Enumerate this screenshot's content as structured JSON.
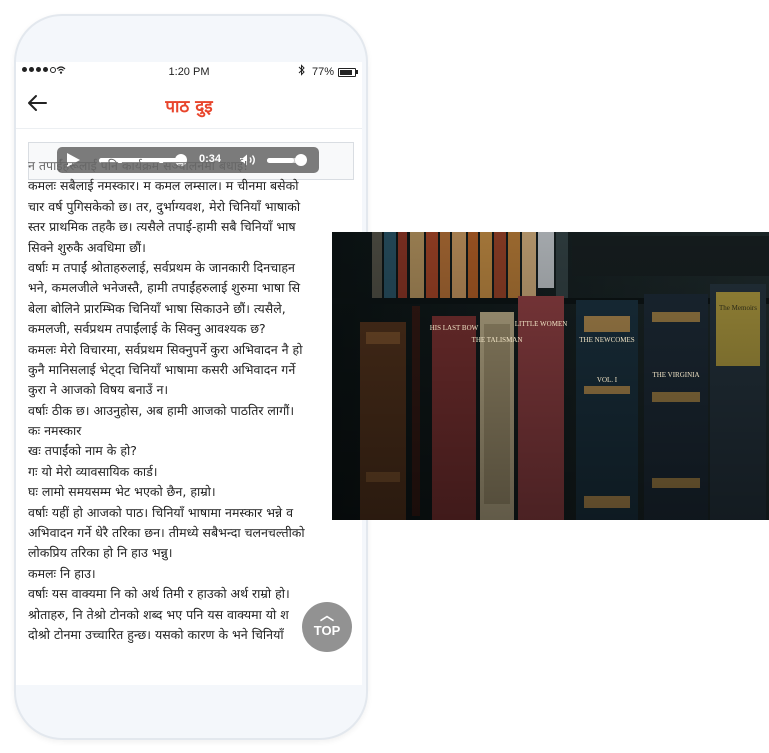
{
  "status_bar": {
    "time": "1:20 PM",
    "battery": "77%",
    "battery_level": 0.77
  },
  "header": {
    "title": "पाठ दुइ",
    "back_icon": "arrow-left-icon"
  },
  "player": {
    "time": "0:34",
    "progress": 0.92,
    "volume": 0.72
  },
  "lesson_lines": [
    "न तपाईंहरूलाई पनि कार्यक्रम सञ्चालनमा बधाई!",
    "कमलः सबैलाई नमस्कार। म कमल लम्साल। म चीनमा बसेको",
    "चार वर्ष पुगिसकेको छ। तर, दुर्भाग्यवश, मेरो चिनियाँ भाषाको",
    "स्तर प्राथमिक तहकै छ। त्यसैले तपाई-हामी सबै चिनियाँ भाष",
    "सिक्ने शुरुकै अवधिमा छौं।",
    "वर्षाः म तपाईं श्रोताहरुलाई, सर्वप्रथम के जानकारी दिनचाहन",
    "भने, कमलजीले भनेजस्तै, हामी तपाईंहरुलाई शुरुमा भाषा सि",
    "बेला बोलिने प्रारम्भिक चिनियाँ भाषा सिकाउने छौं। त्यसैले,",
    "कमलजी, सर्वप्रथम तपाईंलाई के सिक्नु आवश्यक छ?",
    "कमलः मेरो विचारमा, सर्वप्रथम सिक्नुपर्ने कुरा अभिवादन नै हो",
    "कुनै मानिसलाई भेट्दा चिनियाँ भाषामा कसरी अभिवादन गर्ने",
    "कुरा ने आजको विषय बनाउँ न।",
    "वर्षाः ठीक छ। आउनुहोस, अब हामी आजको पाठतिर लागौं।",
    "कः नमस्कार",
    "खः तपाईंको नाम के हो?",
    "गः यो मेरो व्यावसायिक कार्ड।",
    "घः लामो समयसम्म भेट भएको छैन, हाम्रो।",
    "वर्षाः यहीं हो आजको पाठ। चिनियाँ भाषामा नमस्कार भन्ने व",
    "अभिवादन गर्ने धेरै तरिका छन। तीमध्ये सबैभन्दा चलनचल्तीको",
    "लोकप्रिय तरिका हो नि हाउ भन्नु।",
    "कमलः नि हाउ।",
    "वर्षाः यस वाक्यमा नि को अर्थ तिमी र हाउको अर्थ राम्रो हो।",
    "श्रोताहरु, नि तेश्रो टोनको शब्द भए पनि यस वाक्यमा यो श",
    "दोश्रो टोनमा उच्चारित हुन्छ। यसको कारण के भने चिनियाँ"
  ],
  "top_button": {
    "label": "TOP"
  },
  "photo": {
    "spine_texts": [
      "HIS LAST BOW",
      "THE TALISMAN",
      "LITTLE WOMEN",
      "THE NEWCOMES",
      "VOL. I",
      "THE VIRGINIANS",
      "The Memoirs of Field-Marshal Montgomery"
    ]
  }
}
